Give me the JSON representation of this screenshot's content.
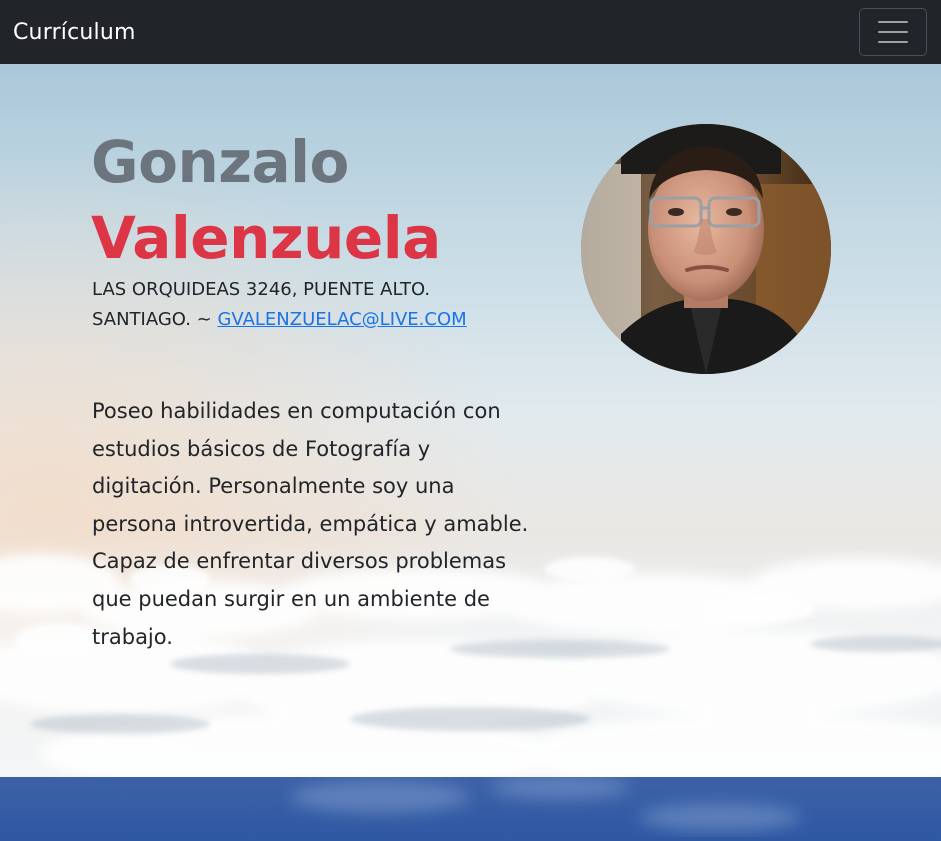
{
  "navbar": {
    "brand": "Currículum",
    "toggler_icon": "hamburger-icon"
  },
  "profile": {
    "first_name": "Gonzalo",
    "last_name": "Valenzuela",
    "address": "Las Orquideas 3246, Puente Alto. Santiago. ~ ",
    "email": "gvalenzuelac@live.com",
    "about": "Poseo habilidades en computación con estudios básicos de Fotografía y digitación. Personalmente soy una persona introvertida, empática y amable. Capaz de enfrentar diversos problemas que puedan surgir en un ambiente de trabajo.",
    "photo": "profile-photo"
  },
  "colors": {
    "navbar_bg": "#212529",
    "first_name": "#6c757d",
    "last_name": "#dc3545",
    "link": "#1a73e8",
    "next_section_bg": "#2f58a3"
  }
}
